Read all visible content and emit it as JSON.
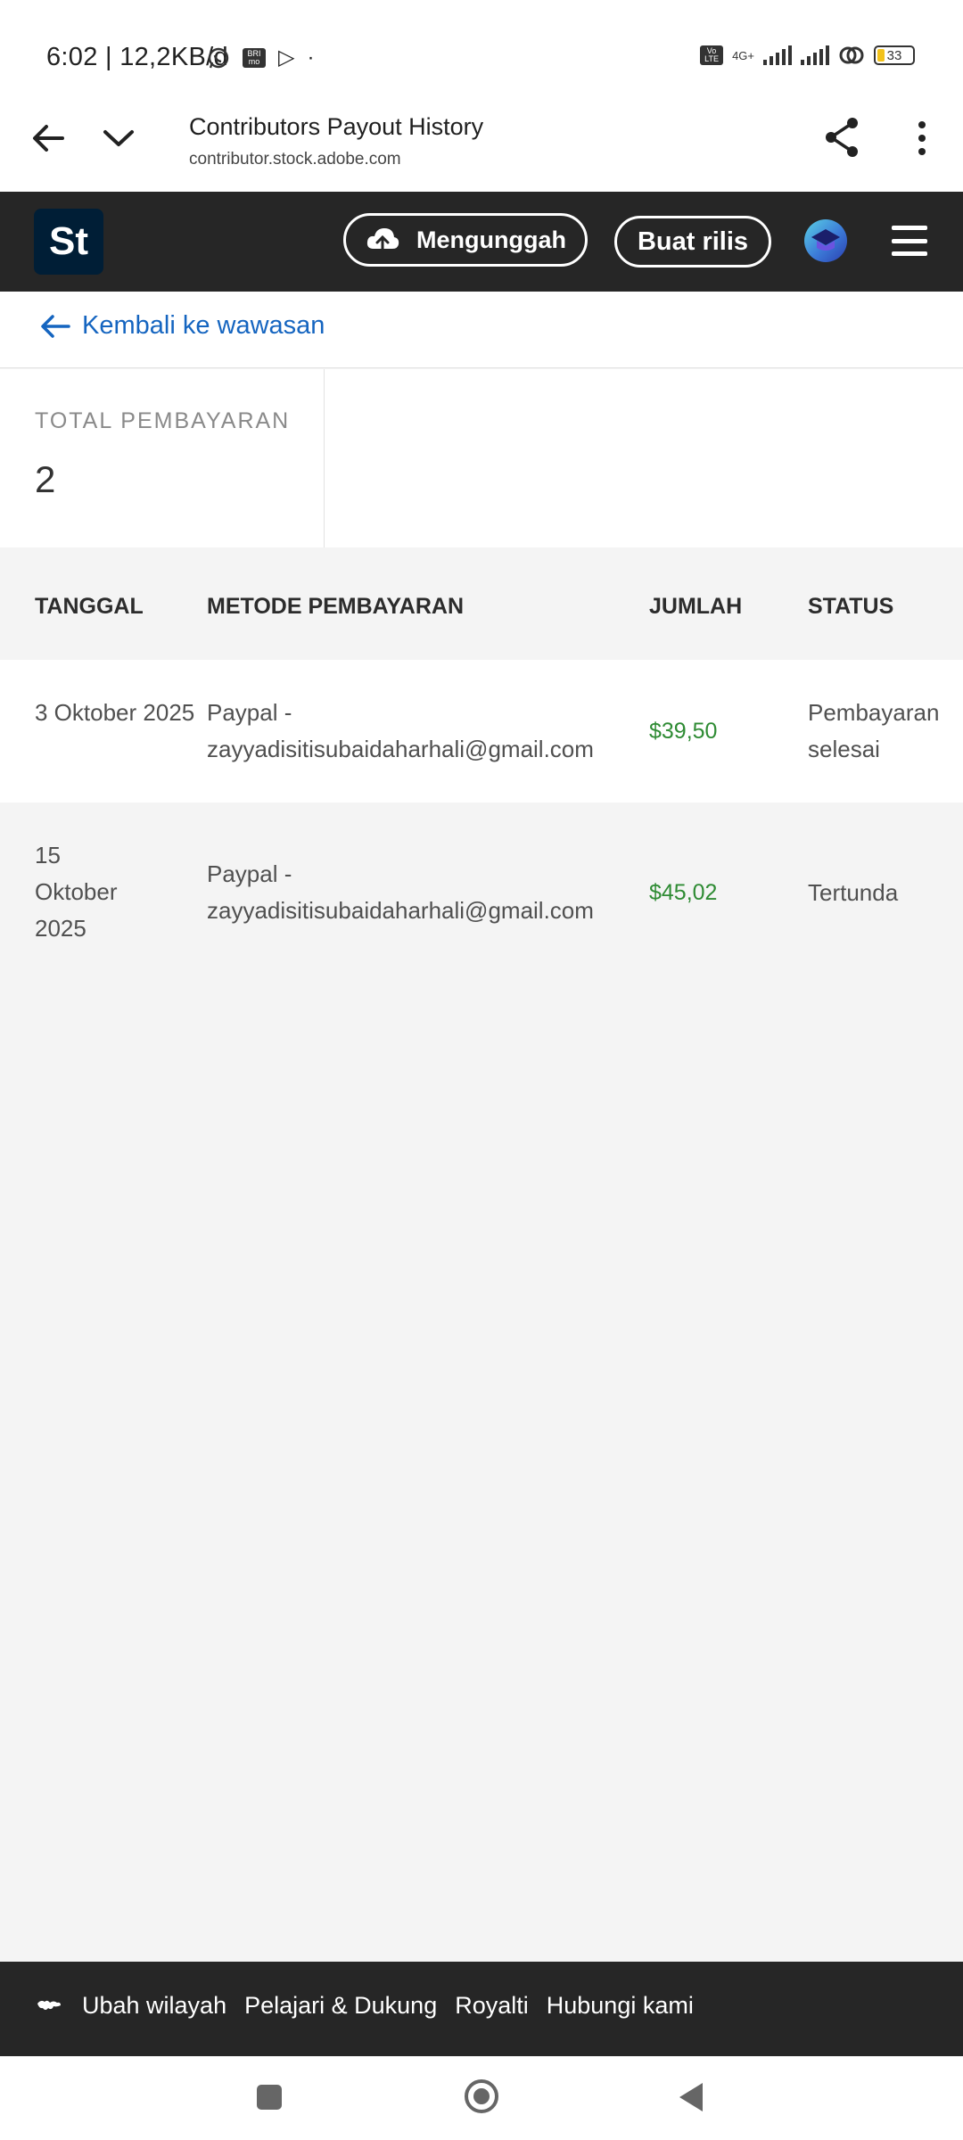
{
  "status_bar": {
    "time_speed": "6:02 | 12,2KB/d",
    "sim_label": "BRI mo",
    "volte_label": "Vo LTE",
    "network_label": "4G+",
    "battery": "33"
  },
  "browser": {
    "page_title": "Contributors Payout History",
    "url": "contributor.stock.adobe.com"
  },
  "header": {
    "logo": "St",
    "upload_label": "Mengunggah",
    "release_label": "Buat rilis"
  },
  "back_link": "Kembali ke wawasan",
  "summary": {
    "label": "TOTAL PEMBAYARAN",
    "value": "2"
  },
  "table": {
    "columns": [
      "TANGGAL",
      "METODE PEMBAYARAN",
      "JUMLAH",
      "STATUS"
    ],
    "rows": [
      {
        "date": "3 Oktober 2025",
        "method": "Paypal - zayyadisitisubaidaharhali@gmail.com",
        "amount": "$39,50",
        "status": "Pembayaran selesai"
      },
      {
        "date": "15 Oktober 2025",
        "method": "Paypal - zayyadisitisubaidaharhali@gmail.com",
        "amount": "$45,02",
        "status": "Tertunda"
      }
    ]
  },
  "footer": {
    "links": [
      "Ubah wilayah",
      "Pelajari & Dukung",
      "Royalti",
      "Hubungi kami"
    ]
  },
  "colors": {
    "header_bg": "#262626",
    "link_blue": "#1565c0",
    "amount_green": "#2e8b33",
    "logo_bg": "#001e36"
  },
  "icons": [
    "back-arrow-icon",
    "chevron-down-icon",
    "share-icon",
    "more-vert-icon",
    "upload-cloud-icon",
    "hamburger-menu-icon",
    "globe-icon"
  ]
}
